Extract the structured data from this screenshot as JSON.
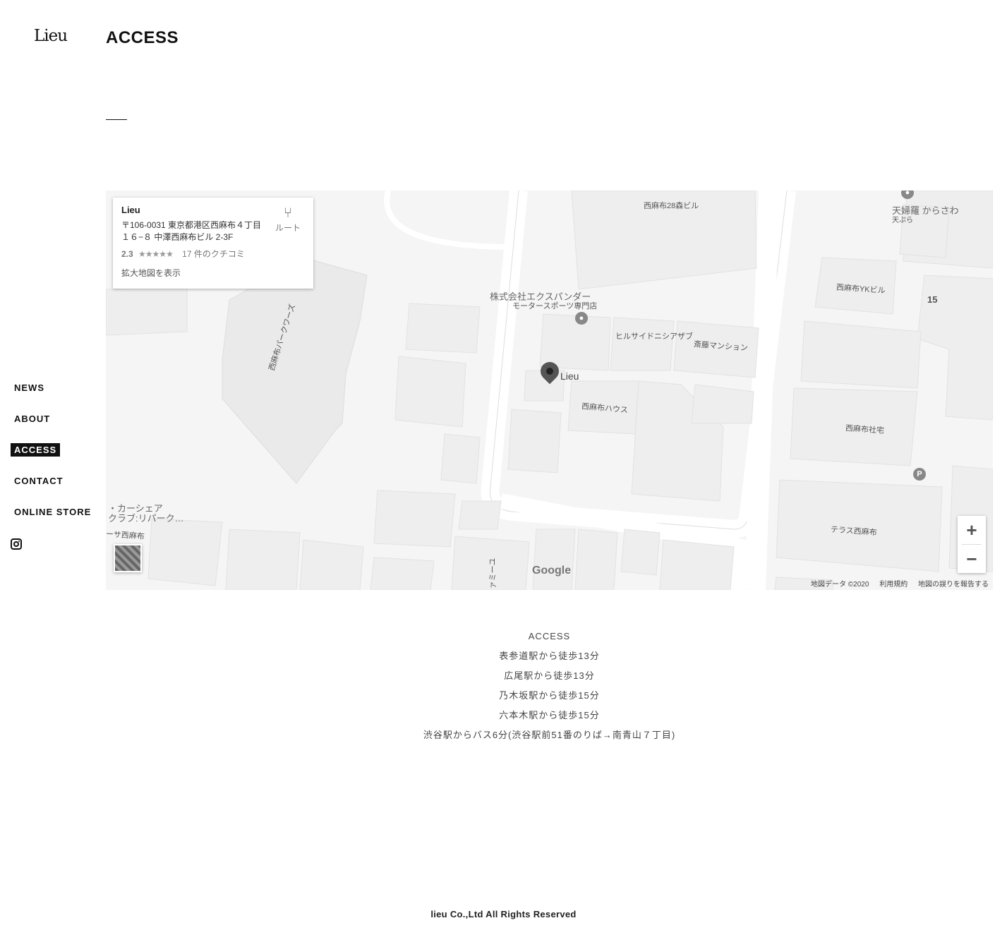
{
  "brand": {
    "logo": "Lieu"
  },
  "header": {
    "title": "ACCESS"
  },
  "nav": {
    "items": [
      {
        "label": "NEWS",
        "active": false
      },
      {
        "label": "ABOUT",
        "active": false
      },
      {
        "label": "ACCESS",
        "active": true
      },
      {
        "label": "CONTACT",
        "active": false
      },
      {
        "label": "ONLINE STORE",
        "active": false
      }
    ],
    "social_icon": "instagram-icon"
  },
  "map": {
    "info_card": {
      "name": "Lieu",
      "address": "〒106-0031 東京都港区西麻布４丁目１６−８ 中澤西麻布ビル 2-3F",
      "rating": "2.3",
      "stars": "★★★★★",
      "reviews": "17 件のクチコミ",
      "enlarge_link": "拡大地図を表示",
      "route_label": "ルート"
    },
    "marker_label": "Lieu",
    "labels": {
      "mori_bldg": "西麻布28森ビル",
      "tempura": "天婦羅 からさわ",
      "tempura_sub": "天ぷら",
      "expander": "株式会社エクスパンダー",
      "expander_sub": "モータースポーツ専門店",
      "yk_bldg": "西麻布YKビル",
      "block_no": "15",
      "hillside": "ヒルサイドニシアザブ",
      "saito": "斎藤マンション",
      "park_wars": "西麻布パークワーズ",
      "nishiazabu_house": "西麻布ハウス",
      "nishiazabu_shataku": "西麻布社宅",
      "terrace": "テラス西麻布",
      "carshare_1": "・カーシェア",
      "carshare_2": "クラブ:リパーク…",
      "nishiazabu_sa": "ーサ西麻布",
      "family": "ファミーユ"
    },
    "zoom_in": "+",
    "zoom_out": "−",
    "google": "Google",
    "footer": {
      "data": "地図データ ©2020",
      "terms": "利用規約",
      "report": "地図の誤りを報告する"
    }
  },
  "access": {
    "heading": "ACCESS",
    "lines": [
      "表参道駅から徒歩13分",
      "広尾駅から徒歩13分",
      "乃木坂駅から徒歩15分",
      "六本木駅から徒歩15分",
      "渋谷駅からバス6分(渋谷駅前51番のりば→南青山７丁目)"
    ]
  },
  "footer": {
    "copyright": "lieu Co.,Ltd All Rights Reserved"
  }
}
